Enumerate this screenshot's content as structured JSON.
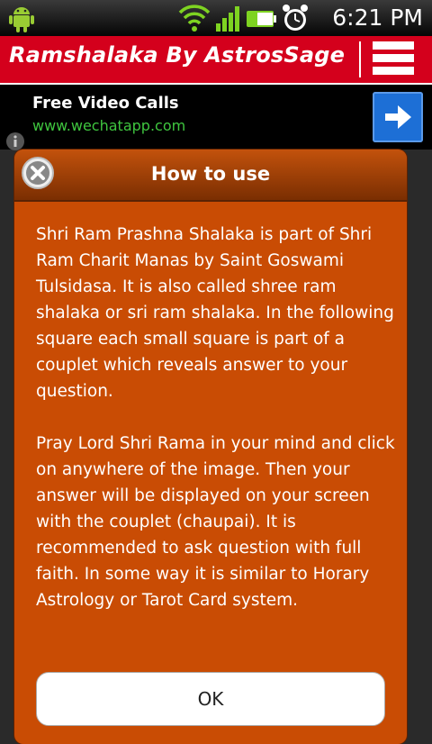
{
  "status_bar": {
    "time": "6:21 PM",
    "icons": [
      "android-icon",
      "wifi-icon",
      "signal-icon",
      "battery-icon",
      "alarm-clock-icon"
    ]
  },
  "app_bar": {
    "title": "Ramshalaka By AstrosSage",
    "menu_icon": "hamburger-menu-icon",
    "accent_color": "#d4001c"
  },
  "ad": {
    "title": "Free Video Calls",
    "url": "www.wechatapp.com",
    "arrow_icon": "arrow-right-icon",
    "info_icon": "info-icon"
  },
  "dialog": {
    "title": "How to use",
    "close_icon": "close-icon",
    "paragraphs": [
      "Shri Ram Prashna Shalaka is part of Shri Ram Charit Manas by Saint Goswami Tulsidasa. It is also called shree ram shalaka or sri ram shalaka. In the following square each small square is part of a couplet which reveals answer to your question.",
      "Pray Lord Shri Rama in your mind and click on anywhere of the image. Then your answer will be displayed on your screen with the couplet (chaupai). It is recommended to ask question with full faith. In some way it is similar to Horary Astrology or Tarot Card system."
    ],
    "ok_label": "OK",
    "background_color": "#c94c04"
  }
}
